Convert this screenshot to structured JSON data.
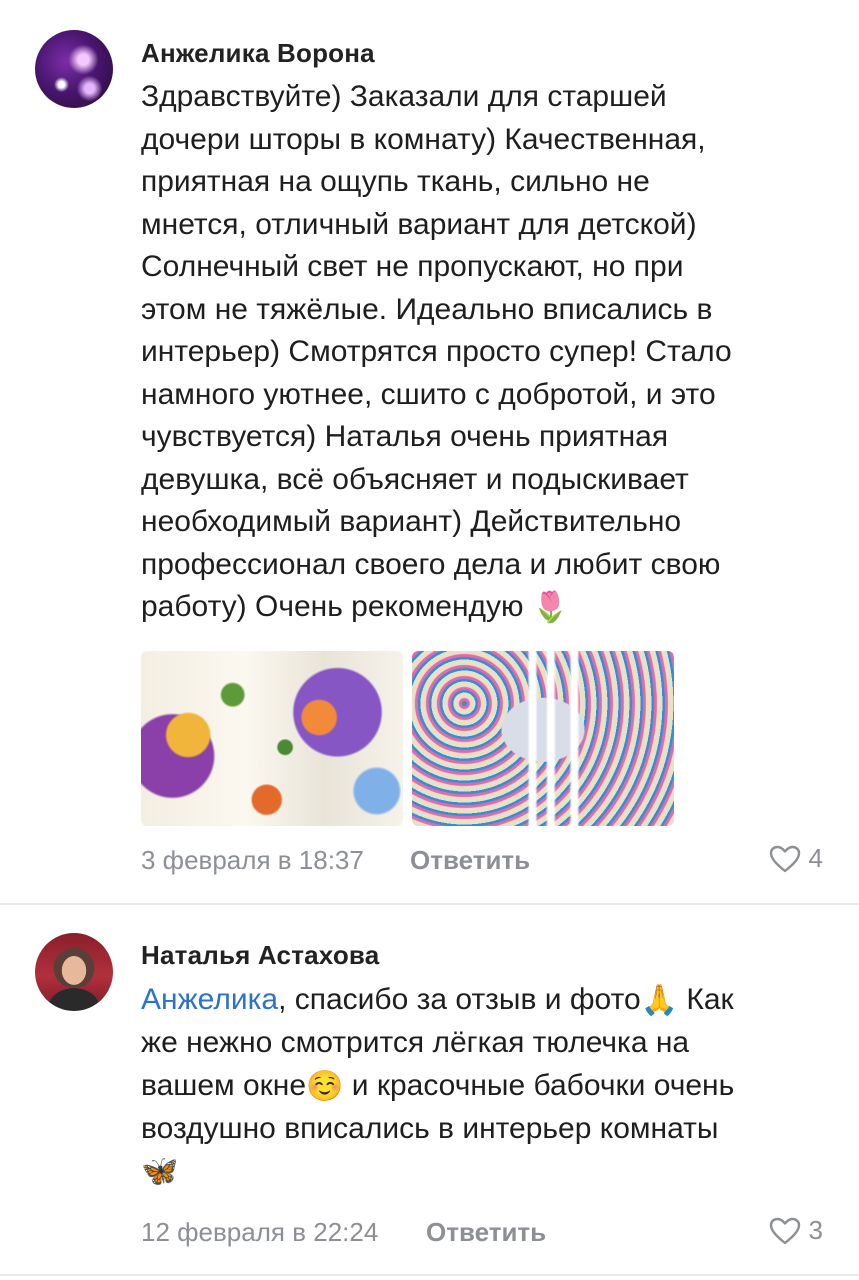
{
  "comments": [
    {
      "author": "Анжелика Ворона",
      "lines": [
        "Здравствуйте) Заказали для старшей",
        "дочери шторы в комнату)  Качественная,",
        "приятная на ощупь ткань, сильно не",
        "мнется, отличный вариант для детской)",
        "Солнечный свет не пропускают, но при",
        "этом не тяжёлые. Идеально вписались в",
        "интерьер) Смотрятся просто супер! Стало",
        "намного уютнее, сшито с добротой, и это",
        "чувствуется) Наталья очень приятная",
        "девушка, всё объясняет и подыскивает",
        "необходимый вариант) Действительно",
        "профессионал своего дела и любит свою",
        "работу) Очень рекомендую"
      ],
      "last_line_emoji": "🌷",
      "photos": [
        "photo-curtain-closeup",
        "photo-curtain-window"
      ],
      "date": "3 февраля в 18:37",
      "reply_label": "Ответить",
      "likes": "4"
    },
    {
      "author": "Наталья Астахова",
      "mention": "Анжелика",
      "line1_rest": ", спасибо за отзыв и фото",
      "emoji_pray": "🙏",
      "line1_end": " Как",
      "line2": "же нежно смотрится лёгкая тюлечка на",
      "line3_start": "вашем окне",
      "emoji_smile": "☺️",
      "line3_end": "  и красочные бабочки очень",
      "line4": "воздушно вписались в интерьер комнаты",
      "emoji_butterfly": "🦋",
      "date": "12 февраля в 22:24",
      "reply_label": "Ответить",
      "likes": "3"
    }
  ],
  "icons": {
    "like": "heart-outline-icon"
  },
  "colors": {
    "mention": "#2a73c9",
    "meta": "#8c8f94"
  }
}
